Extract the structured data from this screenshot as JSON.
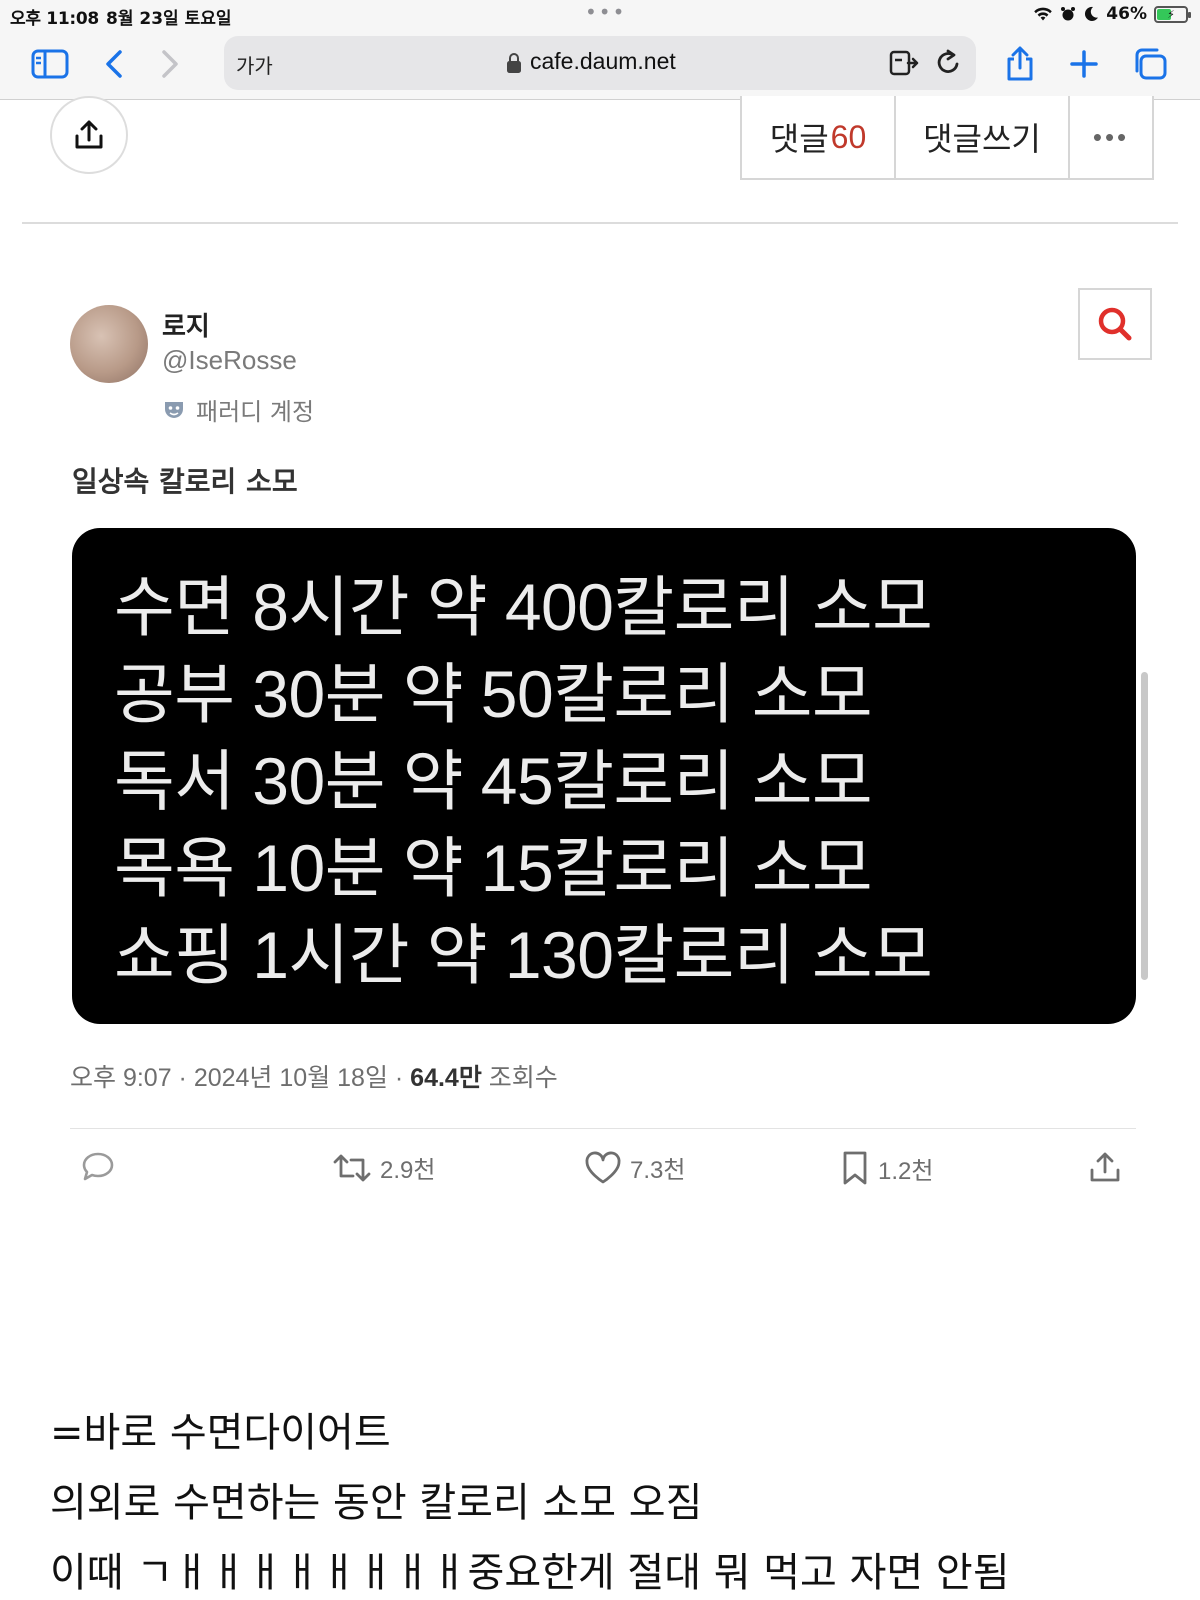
{
  "status_bar": {
    "time": "오후 11:08",
    "date": "8월 23일 토요일",
    "battery": "46%"
  },
  "browser": {
    "text_size_label": "가가",
    "domain": "cafe.daum.net"
  },
  "comments": {
    "label": "댓글",
    "count": "60",
    "write_label": "댓글쓰기",
    "more_label": "•••"
  },
  "tweet": {
    "name": "로지",
    "handle": "@IseRosse",
    "account_label": "패러디 계정",
    "text": "일상속 칼로리 소모",
    "image_lines": [
      "수면 8시간 약 400칼로리 소모",
      "공부 30분 약 50칼로리 소모",
      "독서 30분 약 45칼로리 소모",
      "목욕 10분 약 15칼로리 소모",
      "쇼핑 1시간 약 130칼로리 소모"
    ],
    "timestamp": "오후 9:07 · 2024년 10월 18일 · ",
    "views": "64.4만",
    "views_label": " 조회수",
    "retweets": "2.9천",
    "likes": "7.3천",
    "bookmarks": "1.2천"
  },
  "post_body": [
    "=바로 수면다이어트",
    "의외로 수면하는 동안 칼로리 소모 오짐",
    "이때 ㄱㅐㅐㅐㅐㅐㅐㅐㅐ중요한게 절대 뭐 먹고 자면 안됨"
  ],
  "colors": {
    "accent": "#1a73e8",
    "comment_count": "#c0392b",
    "search": "#e0302b"
  }
}
